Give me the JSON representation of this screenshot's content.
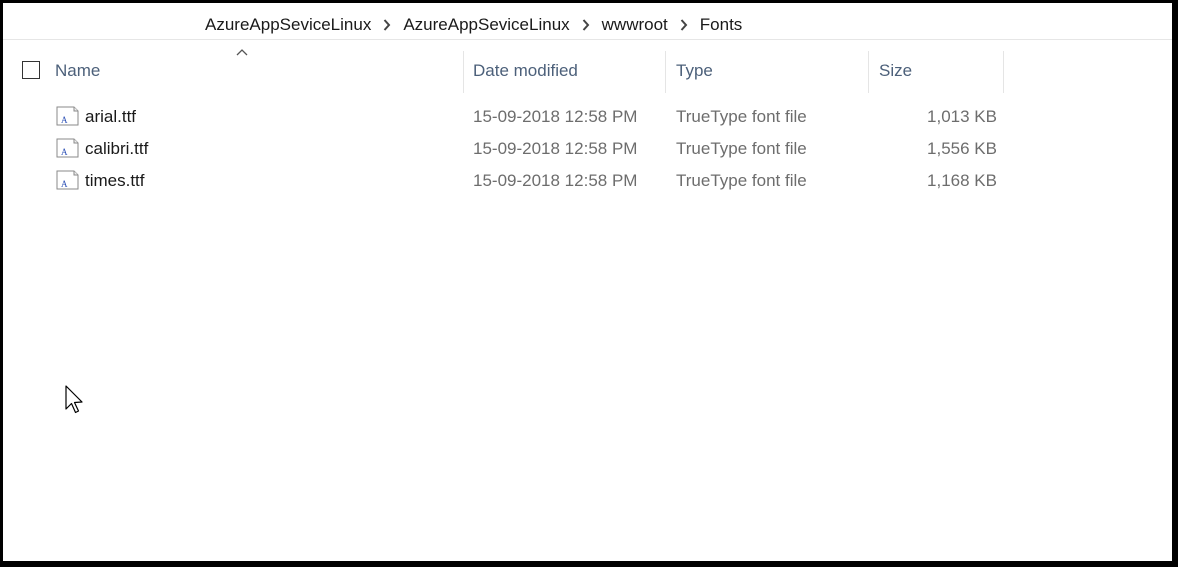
{
  "breadcrumb": {
    "items": [
      "AzureAppSeviceLinux",
      "AzureAppSeviceLinux",
      "wwwroot",
      "Fonts"
    ]
  },
  "columns": {
    "name": "Name",
    "date_modified": "Date modified",
    "type": "Type",
    "size": "Size"
  },
  "sort": {
    "column": "name",
    "direction": "ascending"
  },
  "files": [
    {
      "name": "arial.ttf",
      "date_modified": "15-09-2018 12:58 PM",
      "type": "TrueType font file",
      "size": "1,013 KB",
      "icon": "font-file-icon"
    },
    {
      "name": "calibri.ttf",
      "date_modified": "15-09-2018 12:58 PM",
      "type": "TrueType font file",
      "size": "1,556 KB",
      "icon": "font-file-icon"
    },
    {
      "name": "times.ttf",
      "date_modified": "15-09-2018 12:58 PM",
      "type": "TrueType font file",
      "size": "1,168 KB",
      "icon": "font-file-icon"
    }
  ],
  "colors": {
    "header_text": "#4c607a",
    "row_text": "#1a1a1a",
    "secondary_text": "#6d6d6d",
    "font_icon_accent": "#2b4fb5"
  }
}
